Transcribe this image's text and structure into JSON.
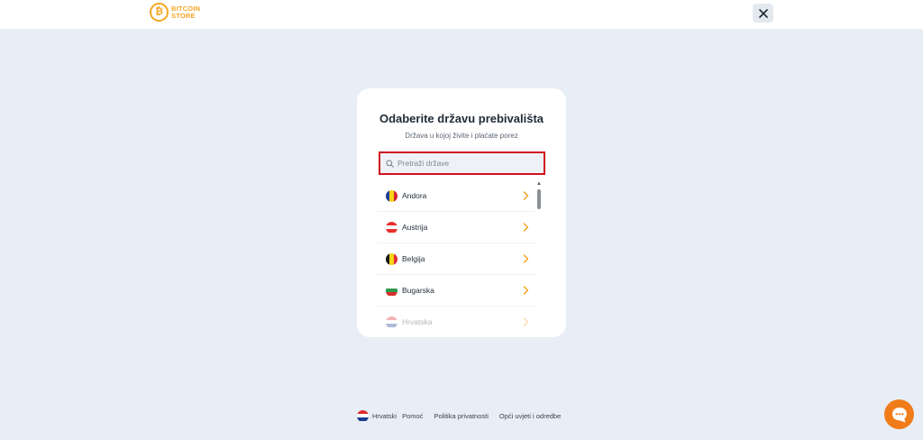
{
  "header": {
    "logo_line1": "BITCOIN",
    "logo_line2": "STORE",
    "logo_icon": "bitcoin-icon",
    "close_icon": "close-icon",
    "accent": "#f5a623"
  },
  "modal": {
    "title": "Odaberite državu prebivališta",
    "subtitle": "Država u kojoj živite i plaćate porez",
    "search": {
      "placeholder": "Pretraži države",
      "value": "",
      "icon": "search-icon",
      "border_color": "#d0101e"
    },
    "countries": [
      {
        "name": "Andora",
        "flag": "andorra-flag-icon",
        "colors": [
          "#1f3f9c",
          "#f7d417",
          "#d3212e"
        ],
        "orientation": "vertical"
      },
      {
        "name": "Austrija",
        "flag": "austria-flag-icon",
        "colors": [
          "#e8302f",
          "#ffffff",
          "#e8302f"
        ],
        "orientation": "horizontal"
      },
      {
        "name": "Belgija",
        "flag": "belgium-flag-icon",
        "colors": [
          "#1a1a1a",
          "#f7d417",
          "#e32b37"
        ],
        "orientation": "vertical"
      },
      {
        "name": "Bugarska",
        "flag": "bulgaria-flag-icon",
        "colors": [
          "#ffffff",
          "#2e9a4e",
          "#d6302c"
        ],
        "orientation": "horizontal"
      },
      {
        "name": "Hrvatska",
        "flag": "croatia-flag-icon",
        "colors": [
          "#e02b2b",
          "#ffffff",
          "#1a3b8f"
        ],
        "orientation": "horizontal"
      }
    ],
    "chevron_icon": "chevron-right-icon",
    "chevron_color": "#f5a623"
  },
  "footer": {
    "language": "Hrvatski",
    "language_flag": "croatia-flag-icon",
    "links": [
      "Pomoć",
      "Politika privatnosti",
      "Opći uvjeti i odredbe"
    ]
  },
  "chat": {
    "icon": "chat-bubble-icon",
    "color": "#f07c1a"
  }
}
